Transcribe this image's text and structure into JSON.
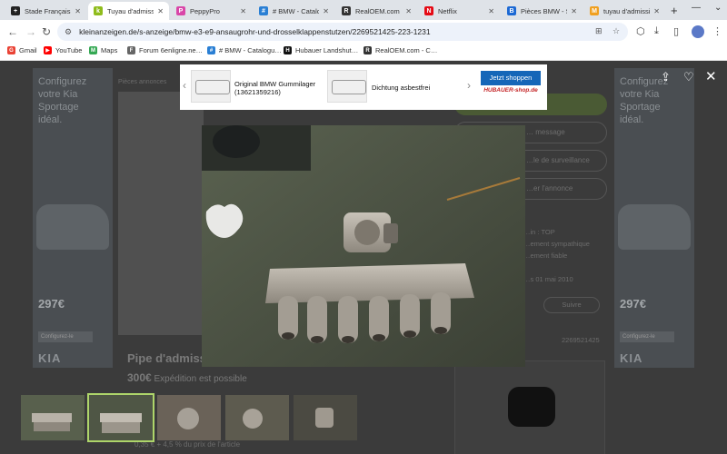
{
  "browser": {
    "tabs": [
      {
        "title": "Stade Français /",
        "color": "#222222",
        "glyph": "+"
      },
      {
        "title": "Tuyau d'admissi…",
        "color": "#8fbc1c",
        "glyph": "k"
      },
      {
        "title": "PeppyPro",
        "color": "#d946a8",
        "glyph": "P"
      },
      {
        "title": "# BMW - Catalo…",
        "color": "#2a7fd4",
        "glyph": "#"
      },
      {
        "title": "RealOEM.com -",
        "color": "#333333",
        "glyph": "R"
      },
      {
        "title": "Netflix",
        "color": "#e50914",
        "glyph": "N"
      },
      {
        "title": "Pièces BMW - S…",
        "color": "#1c69d4",
        "glyph": "B"
      },
      {
        "title": "tuyau d'admissi…",
        "color": "#f0a020",
        "glyph": "M"
      }
    ],
    "new_tab_glyph": "+",
    "url": "kleinanzeigen.de/s-anzeige/bmw-e3-e9-ansaugrohr-und-drosselklappenstutzen/2269521425-223-1231",
    "bookmarks": [
      {
        "label": "Gmail",
        "color": "#ea4335",
        "glyph": "G"
      },
      {
        "label": "YouTube",
        "color": "#ff0000",
        "glyph": "▶"
      },
      {
        "label": "Maps",
        "color": "#34a853",
        "glyph": "M"
      },
      {
        "label": "Forum 6enligne.ne…",
        "color": "#666666",
        "glyph": "F"
      },
      {
        "label": "# BMW - Catalogu…",
        "color": "#2a7fd4",
        "glyph": "#"
      },
      {
        "label": "Hubauer Landshut…",
        "color": "#111111",
        "glyph": "H"
      },
      {
        "label": "RealOEM.com - C…",
        "color": "#333333",
        "glyph": "R"
      }
    ]
  },
  "ad": {
    "product1": "Original BMW Gummilager (13621359216)",
    "product2": "Dichtung asbestfrei",
    "cta": "Jetzt shoppen",
    "shop": "HUBAUER-shop.de"
  },
  "kia_ads": {
    "headline": [
      "Configurez",
      "votre Kia",
      "Sportage",
      "idéal."
    ],
    "price": "297€",
    "cta": "Configurez-le",
    "logo": "KIA"
  },
  "listing": {
    "breadcrumb": "Pièces annonces",
    "title": "Pipe d'admiss…",
    "price": "300€",
    "shipping": "Expédition est possible",
    "fee": "0,35 € + 4,5 % du prix de l'article",
    "actions": [
      "…",
      "… message",
      "…le de surveillance",
      "…er l'annonce"
    ],
    "seller_lines": [
      "…in : TOP",
      "…ement sympathique",
      "…ement fiable",
      "…s 01 mai 2010"
    ],
    "save": "Suivre",
    "ad_id": "2269521425"
  },
  "lightbox": {
    "thumb_count": 5,
    "selected_thumb": 2
  }
}
